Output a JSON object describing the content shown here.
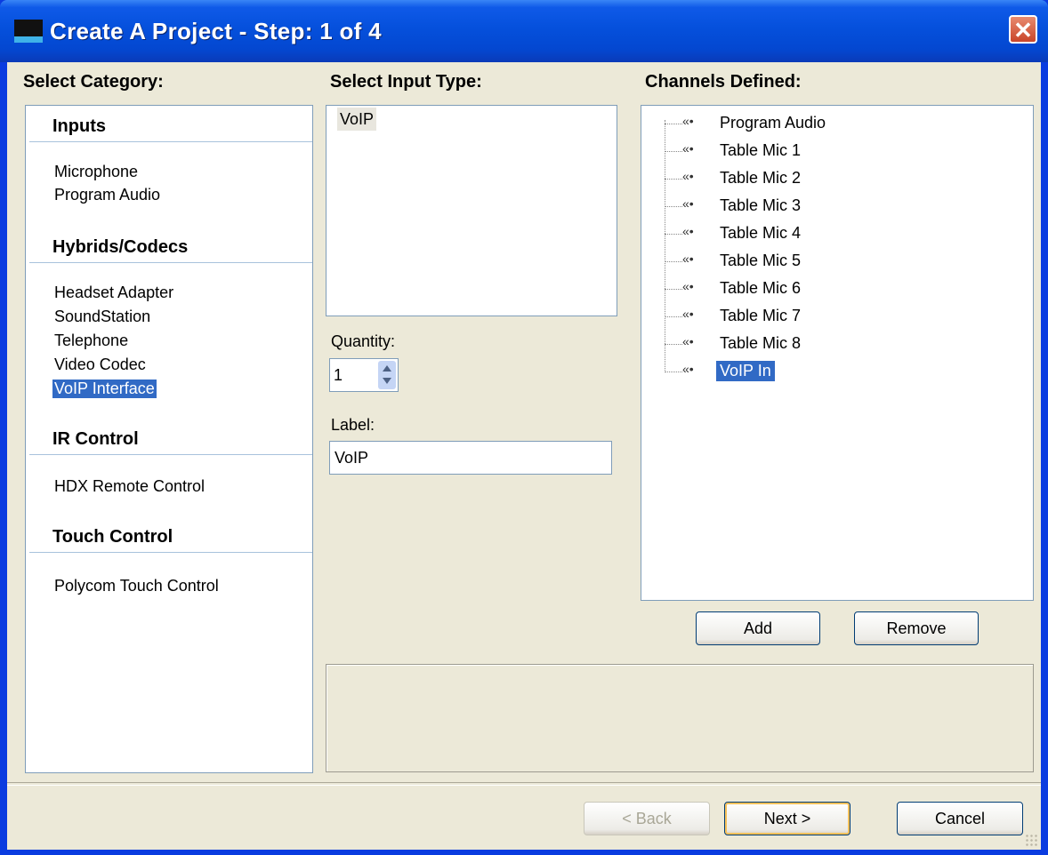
{
  "window": {
    "title": "Create A Project - Step: 1 of 4",
    "close_glyph": "✕"
  },
  "columns": {
    "category_heading": "Select Category:",
    "input_type_heading": "Select Input Type:",
    "channels_heading": "Channels Defined:"
  },
  "categories": {
    "groups": [
      {
        "heading": "Inputs",
        "items": [
          "Microphone",
          "Program Audio"
        ]
      },
      {
        "heading": "Hybrids/Codecs",
        "items": [
          "Headset Adapter",
          "SoundStation",
          "Telephone",
          "Video Codec",
          "VoIP Interface"
        ]
      },
      {
        "heading": "IR Control",
        "items": [
          "HDX Remote Control"
        ]
      },
      {
        "heading": "Touch Control",
        "items": [
          "Polycom Touch Control"
        ]
      }
    ],
    "selected": "VoIP Interface"
  },
  "input_types": {
    "items": [
      "VoIP"
    ]
  },
  "quantity": {
    "label": "Quantity:",
    "value": "1"
  },
  "label_field": {
    "label": "Label:",
    "value": "VoIP"
  },
  "channels": {
    "icon": "«•",
    "items": [
      "Program Audio",
      "Table Mic 1",
      "Table Mic 2",
      "Table Mic 3",
      "Table Mic 4",
      "Table Mic 5",
      "Table Mic 6",
      "Table Mic 7",
      "Table Mic 8",
      "VoIP In"
    ],
    "selected": "VoIP In"
  },
  "channel_buttons": {
    "add": "Add",
    "remove": "Remove"
  },
  "footer": {
    "back": "< Back",
    "next": "Next >",
    "cancel": "Cancel"
  },
  "colors": {
    "title_bar": "#0550dc",
    "selection": "#316ac5",
    "dialog_bg": "#ece9d8"
  }
}
